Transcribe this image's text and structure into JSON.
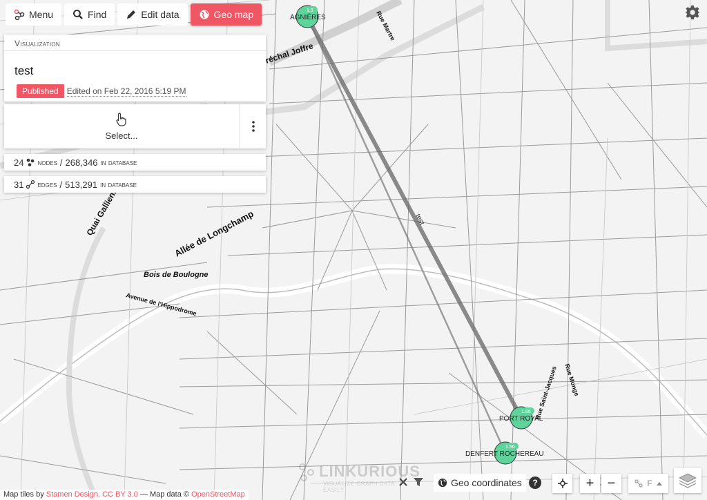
{
  "toolbar": {
    "menu_label": "Menu",
    "find_label": "Find",
    "edit_label": "Edit data",
    "geomap_label": "Geo map"
  },
  "visualization": {
    "header": "Visualization",
    "title": "test",
    "status": "Published",
    "edited": "Edited on Feb 22, 2016 5:19 PM"
  },
  "select": {
    "label": "Select..."
  },
  "stats": {
    "nodes_count": "24",
    "nodes_label": "nodes",
    "nodes_total": "268,346",
    "edges_count": "31",
    "edges_label": "edges",
    "edges_total": "513,291",
    "in_database": "in database"
  },
  "map": {
    "nodes": [
      {
        "label": "AGNIÈRES",
        "badge": "1.5"
      },
      {
        "label": "PORT ROYAL",
        "badge": "1.56"
      },
      {
        "label": "DENFERT ROCHEREAU",
        "badge": "1.56"
      }
    ],
    "edge_label": "test",
    "streets": {
      "quai_gallieni": "Quai Gallieni",
      "allee_longchamp": "Allée de Longchamp",
      "bois_boulogne": "Bois de Boulogne",
      "avenue_hippodrome": "Avenue de l'Hippodrome",
      "marechal_joffre": "réchal Joffre",
      "rue_martre": "Rue Martre",
      "rue_saint_jacques": "Rue Saint-Jacques",
      "rue_monge": "Rue Monge"
    },
    "node_color": "#5fd39c",
    "accent": "#ef5765"
  },
  "controls": {
    "geo_coordinates": "Geo coordinates",
    "help": "?",
    "zoom_in": "+",
    "zoom_out": "−",
    "layout": "F"
  },
  "watermark": {
    "name": "LINKURIOUS",
    "tagline": "VISUALIZE GRAPH DATA EASILY"
  },
  "attribution": {
    "prefix": "Map tiles by",
    "stamen": "Stamen Design, CC BY 3.0",
    "middle": "— Map data ©",
    "osm": "OpenStreetMap"
  }
}
